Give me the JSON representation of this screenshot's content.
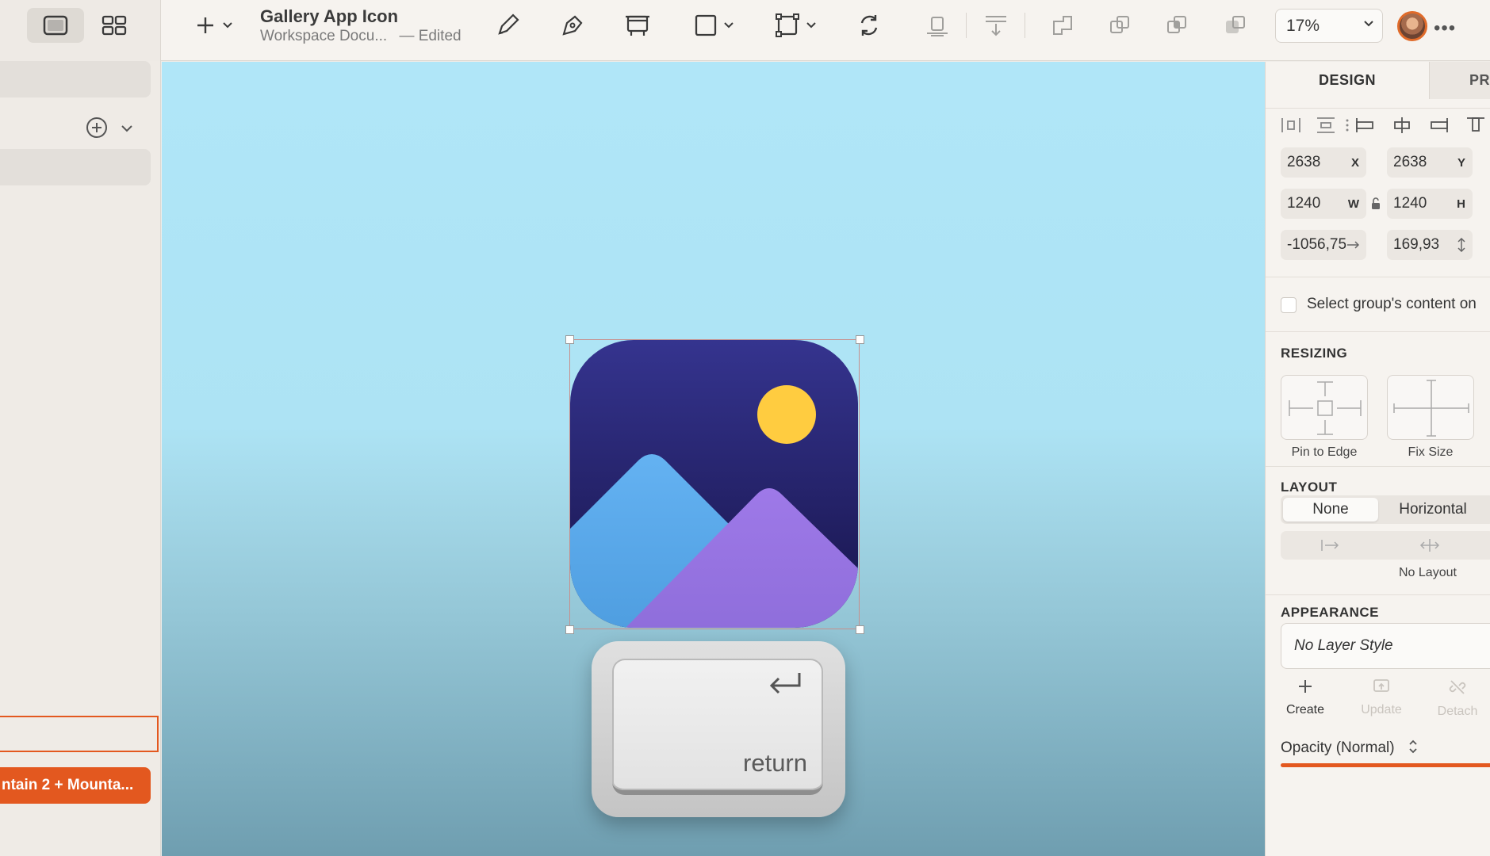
{
  "toolbar": {
    "doc_title": "Gallery App Icon",
    "doc_subtitle": "Workspace Docu...",
    "doc_status": "— Edited",
    "zoom": "17%"
  },
  "sidebar": {
    "selected_layer": "ntain 2 + Mounta..."
  },
  "canvas": {
    "key_label": "return"
  },
  "inspector": {
    "tabs": {
      "design": "DESIGN",
      "prototype": "PR"
    },
    "x": {
      "value": "2638",
      "unit": "X"
    },
    "y": {
      "value": "2638",
      "unit": "Y"
    },
    "w": {
      "value": "1240",
      "unit": "W"
    },
    "h": {
      "value": "1240",
      "unit": "H"
    },
    "offset_h": {
      "value": "-1056,75"
    },
    "offset_v": {
      "value": "169,93"
    },
    "select_group_label": "Select group's content on",
    "resizing": {
      "title": "RESIZING",
      "pin_label": "Pin to Edge",
      "fix_label": "Fix Size"
    },
    "layout": {
      "title": "LAYOUT",
      "none": "None",
      "horizontal": "Horizontal",
      "no_layout": "No Layout"
    },
    "appearance": {
      "title": "APPEARANCE",
      "style": "No Layer Style",
      "create": "Create",
      "update": "Update",
      "detach": "Detach"
    },
    "opacity": "Opacity (Normal)"
  },
  "colors": {
    "accent": "#e3581f",
    "sky_top": "#33338f",
    "sun": "#ffcc40",
    "mountain_blue": "#5aa8ec",
    "mountain_purple": "#9472e0"
  }
}
